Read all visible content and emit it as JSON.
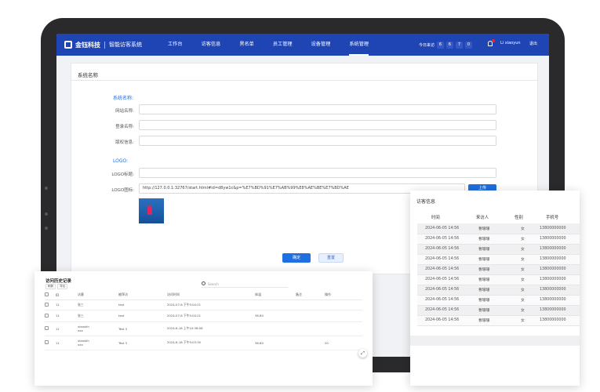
{
  "app": {
    "brand": "金钰科技",
    "system_name": "智能访客系统"
  },
  "nav": {
    "items": [
      "工作台",
      "访客信息",
      "黑名单",
      "员工管理",
      "设备管理",
      "系统管理"
    ],
    "active_index": 5,
    "visitors_label": "今日来访",
    "visitor_digits": [
      "6",
      "6",
      "7",
      "0"
    ],
    "username": "Li xiaoyun",
    "logout": "退出"
  },
  "settings": {
    "card_title": "系统名称",
    "section_name": "系统名称:",
    "fields": [
      {
        "label": "网站名称:",
        "value": ""
      },
      {
        "label": "登录名称:",
        "value": ""
      },
      {
        "label": "版权信息:",
        "value": ""
      }
    ],
    "section_logo": "LOGO:",
    "logo_fields": [
      {
        "label": "LOGO标题:",
        "value": ""
      },
      {
        "label": "LOGO图标:",
        "value": "http://127.0.0.1:32767/start.html#id=d8yw1c&p=%E7%BD%91%E7%AB%99%E8%AE%BE%E7%BD%AE"
      }
    ],
    "upload": "上传",
    "confirm": "确定",
    "reset": "重置"
  },
  "visitor_panel": {
    "title": "访客信息",
    "columns": [
      "时间",
      "来访人",
      "性别",
      "手机号",
      "身"
    ],
    "rows": [
      [
        "2024-06-05  14:56",
        "曹珊珊",
        "女",
        "13800000000"
      ],
      [
        "2024-06-05  14:56",
        "曹珊珊",
        "女",
        "13800000000"
      ],
      [
        "2024-06-05  14:56",
        "曹珊珊",
        "女",
        "13800000000"
      ],
      [
        "2024-06-05  14:56",
        "曹珊珊",
        "女",
        "13800000000"
      ],
      [
        "2024-06-05  14:56",
        "曹珊珊",
        "女",
        "13800000000"
      ],
      [
        "2024-06-05  14:56",
        "曹珊珊",
        "女",
        "13800000000"
      ],
      [
        "2024-06-05  14:56",
        "曹珊珊",
        "女",
        "13800000000"
      ],
      [
        "2024-06-05  14:56",
        "曹珊珊",
        "女",
        "13800000000"
      ],
      [
        "2024-06-05  14:56",
        "曹珊珊",
        "女",
        "13800000000"
      ],
      [
        "2024-06-05  14:56",
        "曹珊珊",
        "女",
        "13800000000"
      ]
    ]
  },
  "history_panel": {
    "title": "访问历史记录",
    "tools": [
      "刷新",
      "导出"
    ],
    "search_placeholder": "Search",
    "columns": [
      "",
      "ID",
      "访客",
      "被拜访",
      "访问时间",
      "体温",
      "备注",
      "操作"
    ],
    "rows": [
      [
        "",
        "11",
        "张三",
        "test",
        "2024-07-8 下午5:04:21",
        "",
        "",
        ""
      ],
      [
        "",
        "11",
        "张三",
        "test",
        "2024-07-8 下午5:04:21",
        "36.80",
        "",
        ""
      ],
      [
        "",
        "11",
        "xiaoshh\nxxx",
        "Test 3",
        "2024-6-18 上午10:36:08",
        "",
        "",
        ""
      ],
      [
        "",
        "11",
        "xiaoshh\nxxx",
        "Test 3",
        "2024-6-18 下午5:03:30",
        "36.60",
        "",
        "20"
      ]
    ]
  },
  "colors": {
    "nav_bg": "#1f45b5",
    "primary": "#1f6fe0",
    "tablet_frame": "#2a2a2c"
  }
}
